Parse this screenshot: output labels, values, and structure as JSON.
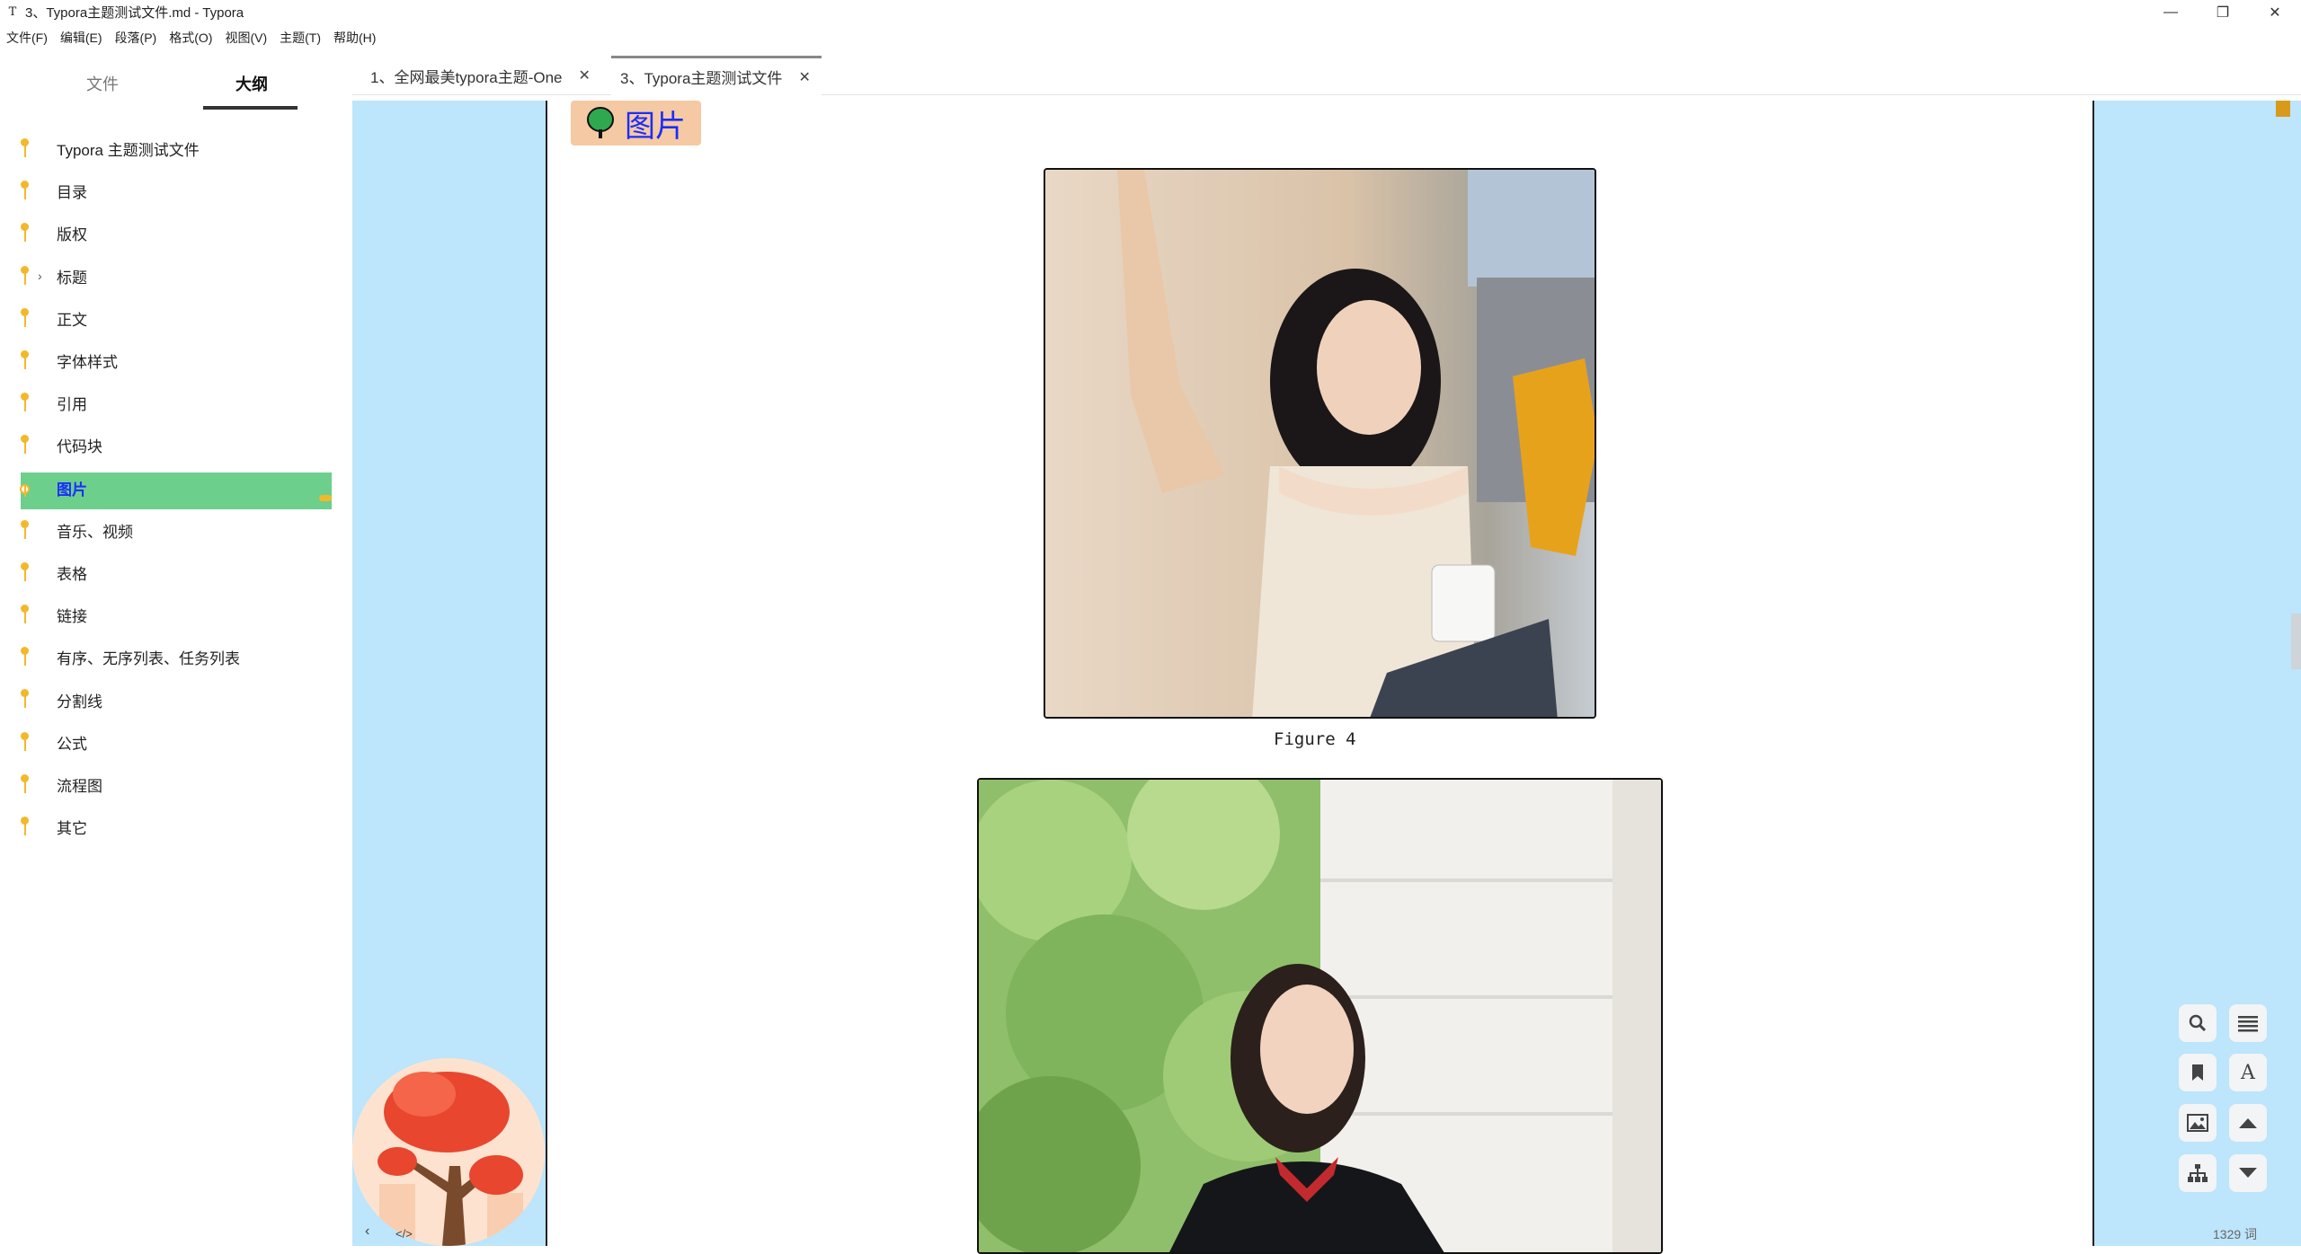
{
  "window": {
    "title": "3、Typora主题测试文件.md - Typora",
    "app_icon": "typora-icon",
    "controls": [
      "minimize-icon",
      "restore-icon",
      "close-icon"
    ]
  },
  "menu": [
    "文件(F)",
    "编辑(E)",
    "段落(P)",
    "格式(O)",
    "视图(V)",
    "主题(T)",
    "帮助(H)"
  ],
  "sidebar": {
    "tabs": [
      {
        "label": "文件",
        "active": false
      },
      {
        "label": "大纲",
        "active": true
      }
    ],
    "outline": [
      {
        "label": "Typora 主题测试文件",
        "active": false,
        "collapsible": false
      },
      {
        "label": "目录",
        "active": false,
        "collapsible": false
      },
      {
        "label": "版权",
        "active": false,
        "collapsible": false
      },
      {
        "label": "标题",
        "active": false,
        "collapsible": true
      },
      {
        "label": "正文",
        "active": false,
        "collapsible": false
      },
      {
        "label": "字体样式",
        "active": false,
        "collapsible": false
      },
      {
        "label": "引用",
        "active": false,
        "collapsible": false
      },
      {
        "label": "代码块",
        "active": false,
        "collapsible": false
      },
      {
        "label": "图片",
        "active": true,
        "collapsible": false
      },
      {
        "label": "音乐、视频",
        "active": false,
        "collapsible": false
      },
      {
        "label": "表格",
        "active": false,
        "collapsible": false
      },
      {
        "label": "链接",
        "active": false,
        "collapsible": false
      },
      {
        "label": "有序、无序列表、任务列表",
        "active": false,
        "collapsible": false
      },
      {
        "label": "分割线",
        "active": false,
        "collapsible": false
      },
      {
        "label": "公式",
        "active": false,
        "collapsible": false
      },
      {
        "label": "流程图",
        "active": false,
        "collapsible": false
      },
      {
        "label": "其它",
        "active": false,
        "collapsible": false
      }
    ],
    "bottom_controls": {
      "collapse": "‹",
      "source": "</>"
    }
  },
  "doc_tabs": [
    {
      "label": "1、全网最美typora主题-One",
      "active": false,
      "close": "✕"
    },
    {
      "label": "3、Typora主题测试文件",
      "active": true,
      "close": "✕"
    }
  ],
  "editor": {
    "heading": "图片",
    "heading_icon": "tree-icon",
    "figures": [
      {
        "caption": "Figure 4",
        "alt": "photo-woman-waving"
      },
      {
        "caption": "",
        "alt": "photo-woman-smiling"
      }
    ],
    "colors": {
      "margin_bg": "#bde5fb",
      "heading_badge": "#f5c9a3",
      "heading_text": "#1a2dff",
      "outline_active": "#6ccf8c",
      "outline_bullet": "#f3b82a"
    }
  },
  "toolbar": {
    "buttons": [
      "search-icon",
      "list-icon",
      "bookmark-icon",
      "font-icon",
      "image-icon",
      "scroll-up-icon",
      "sitemap-icon",
      "scroll-down-icon"
    ]
  },
  "status": {
    "word_count": "1329 词"
  }
}
